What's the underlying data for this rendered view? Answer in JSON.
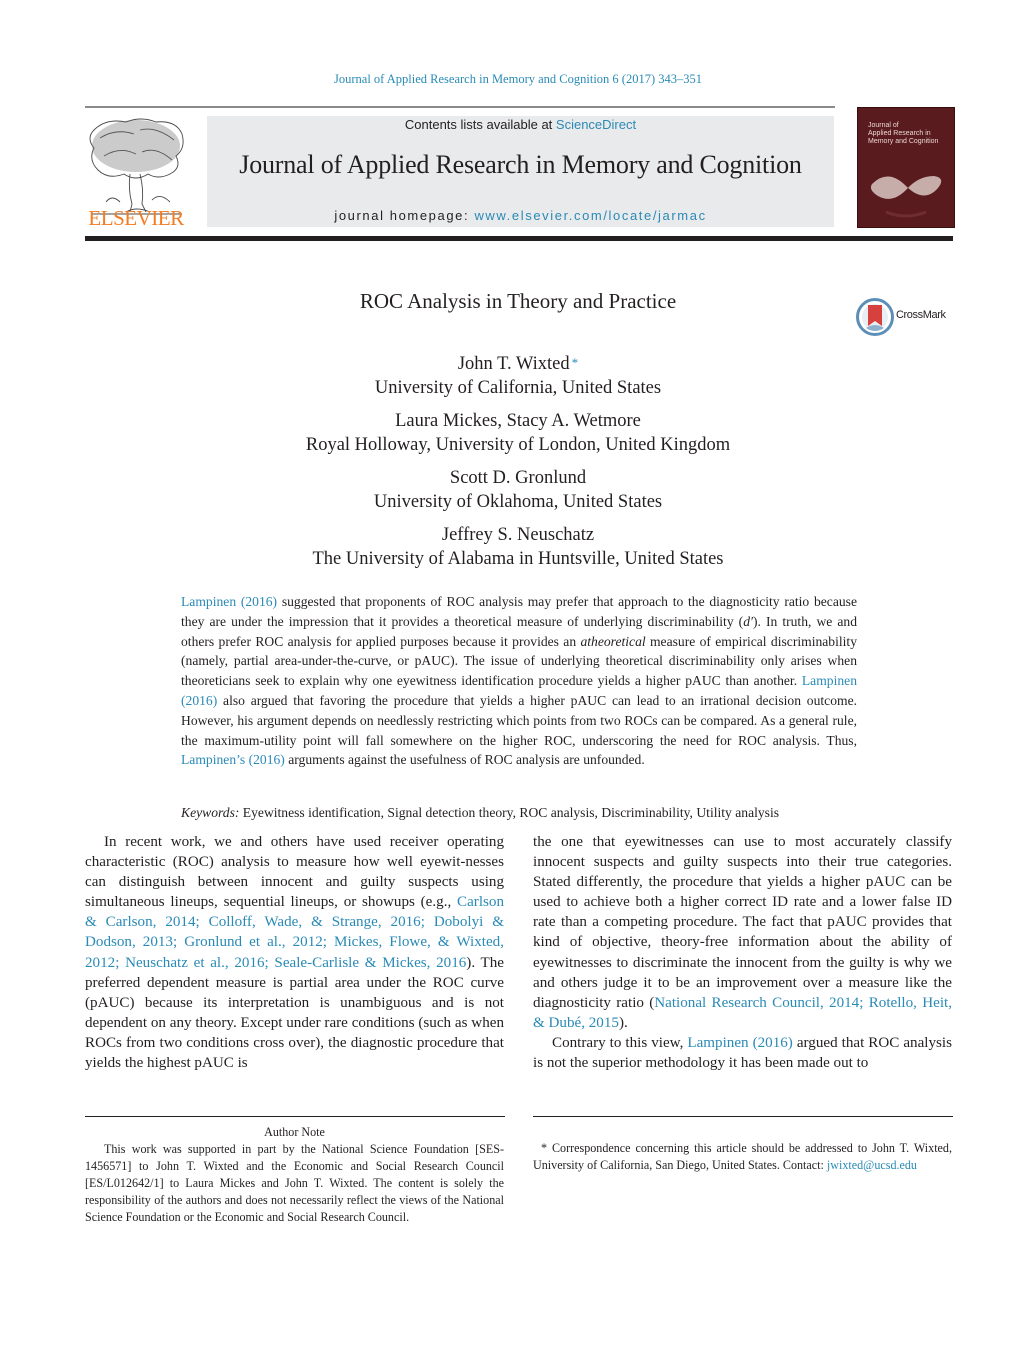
{
  "running_head": "Journal of Applied Research in Memory and Cognition 6 (2017) 343–351",
  "masthead": {
    "publisher": "ELSEVIER",
    "contents_prefix": "Contents lists available at ",
    "contents_link": "ScienceDirect",
    "journal_name": "Journal of Applied Research in Memory and Cognition",
    "homepage_prefix": "journal homepage: ",
    "homepage_link": "www.elsevier.com/locate/jarmac",
    "cover_title_lines": [
      "Journal of",
      "Applied Research in",
      "Memory and Cognition"
    ]
  },
  "colors": {
    "link": "#2a8ab6",
    "publisher_orange": "#f47b20",
    "masthead_bg": "#e9eaeb",
    "cover_bg": "#5a1b1e"
  },
  "article": {
    "title": "ROC Analysis in Theory and Practice",
    "crossmark_label": "CrossMark",
    "authors": [
      {
        "names": "John T. Wixted",
        "star": "*",
        "affiliation": "University of California, United States"
      },
      {
        "names": "Laura Mickes, Stacy A. Wetmore",
        "star": "",
        "affiliation": "Royal Holloway, University of London, United Kingdom"
      },
      {
        "names": "Scott D. Gronlund",
        "star": "",
        "affiliation": "University of Oklahoma, United States"
      },
      {
        "names": "Jeffrey S. Neuschatz",
        "star": "",
        "affiliation": "The University of Alabama in Huntsville, United States"
      }
    ]
  },
  "abstract": {
    "link1": "Lampinen (2016)",
    "t1": " suggested that proponents of ROC analysis may prefer that approach to the diagnosticity ratio because they are under the impression that it provides a theoretical measure of underlying discriminability (",
    "dprime": "d′",
    "t2": "). In truth, we and others prefer ROC analysis for applied purposes because it provides an ",
    "atheoretical": "atheoretical",
    "t3": " measure of empirical discriminability (namely, partial area-under-the-curve, or pAUC). The issue of underlying theoretical discriminability only arises when theoreticians seek to explain why one eyewitness identification procedure yields a higher pAUC than another. ",
    "link2": "Lampinen (2016)",
    "t4": " also argued that favoring the procedure that yields a higher pAUC can lead to an irrational decision outcome. However, his argument depends on needlessly restricting which points from two ROCs can be compared. As a general rule, the maximum-utility point will fall somewhere on the higher ROC, underscoring the need for ROC analysis. Thus, ",
    "link3": "Lampinen’s (2016)",
    "t5": " arguments against the usefulness of ROC analysis are unfounded."
  },
  "keywords": {
    "label": "Keywords:",
    "list": " Eyewitness identification, Signal detection theory, ROC analysis, Discriminability, Utility analysis"
  },
  "body": {
    "p1_t1": "In recent work, we and others have used receiver operating characteristic (ROC) analysis to measure how well eyewit-nesses can distinguish between innocent and guilty suspects using simultaneous lineups, sequential lineups, or showups (e.g., ",
    "p1_refs": "Carlson & Carlson, 2014; Colloff, Wade, & Strange, 2016; Dobolyi & Dodson, 2013; Gronlund et al., 2012; Mickes, Flowe, & Wixted, 2012; Neuschatz et al., 2016; Seale-Carlisle & Mickes, 2016",
    "p1_t2": "). The preferred dependent measure is partial area under the ROC curve (pAUC) because its interpretation is unambiguous and is not dependent on any theory. Except under rare conditions (such as when ROCs from two conditions cross over), the diagnostic procedure that yields the highest pAUC is the one that eyewitnesses can use to most accurately classify innocent suspects and guilty suspects into their true categories. Stated differently, the procedure that yields a higher pAUC can be used to achieve both a higher correct ID rate and a lower false ID rate than a competing procedure. The fact that pAUC provides that kind of objective, theory-free information about the ability of eyewitnesses to discriminate the innocent from the guilty is why we and others judge it to be an improvement over a measure like the diagnosticity ratio (",
    "p1_refs2": "National Research Council, 2014; Rotello, Heit, & Dubé, 2015",
    "p1_t3": ").",
    "p2_t1": "Contrary to this view, ",
    "p2_link": "Lampinen (2016)",
    "p2_t2": " argued that ROC analysis is not the superior methodology it has been made out to"
  },
  "footnotes": {
    "author_note_heading": "Author Note",
    "author_note_body": "This work was supported in part by the National Science Foundation [SES-1456571] to John T. Wixted and the Economic and Social Research Council [ES/L012642/1] to Laura Mickes and John T. Wixted. The content is solely the responsibility of the authors and does not necessarily reflect the views of the National Science Foundation or the Economic and Social Research Council.",
    "correspondence_star": "*",
    "correspondence_text": " Correspondence concerning this article should be addressed to John T. Wixted, University of California, San Diego, United States. Contact: ",
    "correspondence_email": "jwixted@ucsd.edu"
  }
}
